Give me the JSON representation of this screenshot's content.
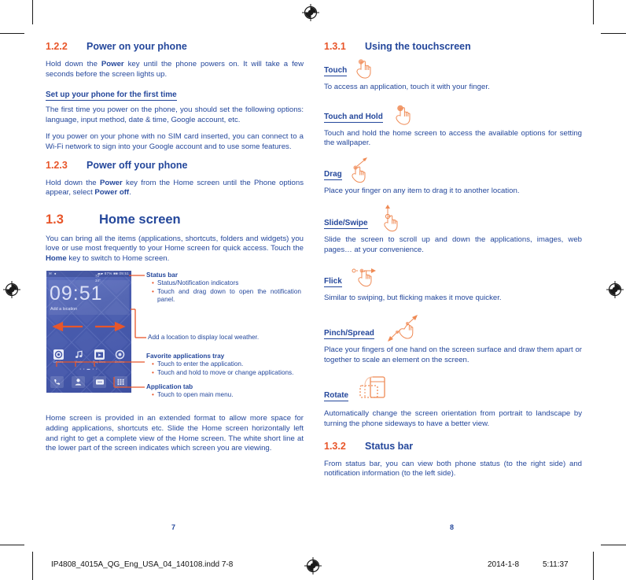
{
  "document": {
    "left_page_number": "7",
    "right_page_number": "8",
    "slug_filename": "IP4808_4015A_QG_Eng_USA_04_140108.indd   7-8",
    "slug_date": "2014-1-8",
    "slug_time": "5:11:37"
  },
  "colors": {
    "heading_blue": "#24479b",
    "accent_orange": "#e8562a",
    "body_blue": "#24479b"
  },
  "left_column": {
    "sections": [
      {
        "number": "1.2.2",
        "title": "Power on your phone",
        "paragraphs": [
          "Hold down the Power key until the phone powers on. It will take a few seconds before the screen lights up."
        ],
        "subheading": "Set up your phone for the first time",
        "after_subheading": [
          "The first time you power on the phone, you should set the following options: language, input method, date & time, Google account, etc.",
          "If you power on your phone with no SIM card inserted, you can connect to a Wi-Fi network to sign into your Google account and to use some features."
        ]
      },
      {
        "number": "1.2.3",
        "title": "Power off your phone",
        "paragraphs": [
          "Hold down the Power key from the Home screen until the Phone options appear, select Power off."
        ]
      },
      {
        "number": "1.3",
        "title": "Home screen",
        "paragraphs": [
          "You can bring all the items (applications, shortcuts, folders and widgets) you love or use most frequently to your Home screen for quick access. Touch the Home key to switch to Home screen."
        ]
      }
    ],
    "closing_paragraph": "Home screen is provided in an extended format to allow more space for adding applications, shortcuts etc. Slide the Home screen horizontally left and right to get a complete view of the Home screen. The white short line at the lower part of the screen indicates which screen you are viewing."
  },
  "phone_illustration": {
    "status_bar_left": "✉ ●",
    "status_bar_right": "▰▰  87%  ■■  09:51",
    "clock": "09:51",
    "weather_small": "72°\n34°",
    "add_location": "Add a location",
    "page_dots": "• • ▬ • •",
    "apps": [
      {
        "label": "Camera",
        "icon": "camera-icon"
      },
      {
        "label": "Music",
        "icon": "music-icon"
      },
      {
        "label": "Play Store",
        "icon": "play-store-icon"
      },
      {
        "label": "Chrome",
        "icon": "chrome-icon"
      }
    ],
    "tray": [
      {
        "label": "Phone",
        "icon": "phone-handset-icon"
      },
      {
        "label": "Contacts",
        "icon": "contacts-person-icon"
      },
      {
        "label": "Messaging",
        "icon": "messaging-icon"
      },
      {
        "label": "Application tab",
        "icon": "app-drawer-grid-icon"
      }
    ],
    "callouts": [
      {
        "title": "Status bar",
        "items": [
          "Status/Notification indicators",
          "Touch and drag down to open the notification panel."
        ]
      },
      {
        "title": "",
        "items": [
          "Add a location to display local weather."
        ]
      },
      {
        "title": "Favorite applications tray",
        "items": [
          "Touch to enter the application.",
          "Touch and hold to move or change applications."
        ]
      },
      {
        "title": "Application tab",
        "items": [
          "Touch to open main menu."
        ]
      }
    ]
  },
  "right_column": {
    "sections": [
      {
        "number": "1.3.1",
        "title": "Using the touchscreen"
      },
      {
        "number": "1.3.2",
        "title": "Status bar",
        "paragraph": "From status bar, you can view both phone status (to the right side) and notification information (to the left side)."
      }
    ],
    "gestures": [
      {
        "name": "Touch",
        "icon": "hand-touch-icon",
        "description": "To access an application, touch it with your finger."
      },
      {
        "name": "Touch and Hold",
        "icon": "hand-touch-hold-icon",
        "description": "Touch and hold the home screen to access the available options for setting the wallpaper."
      },
      {
        "name": "Drag",
        "icon": "hand-drag-icon",
        "description": "Place your finger on any item to drag it to another location."
      },
      {
        "name": "Slide/Swipe",
        "icon": "hand-slide-swipe-icon",
        "description": "Slide the screen to scroll up and down the applications, images, web pages… at your convenience."
      },
      {
        "name": "Flick",
        "icon": "hand-flick-icon",
        "description": "Similar to swiping, but flicking makes it move quicker."
      },
      {
        "name": "Pinch/Spread",
        "icon": "hand-pinch-spread-icon",
        "description": "Place your fingers of one hand on the screen surface and draw them apart or together to scale an element on the screen."
      },
      {
        "name": "Rotate",
        "icon": "device-rotate-icon",
        "description": "Automatically change the screen orientation from portrait to landscape by turning the phone sideways to have a better view."
      }
    ]
  }
}
